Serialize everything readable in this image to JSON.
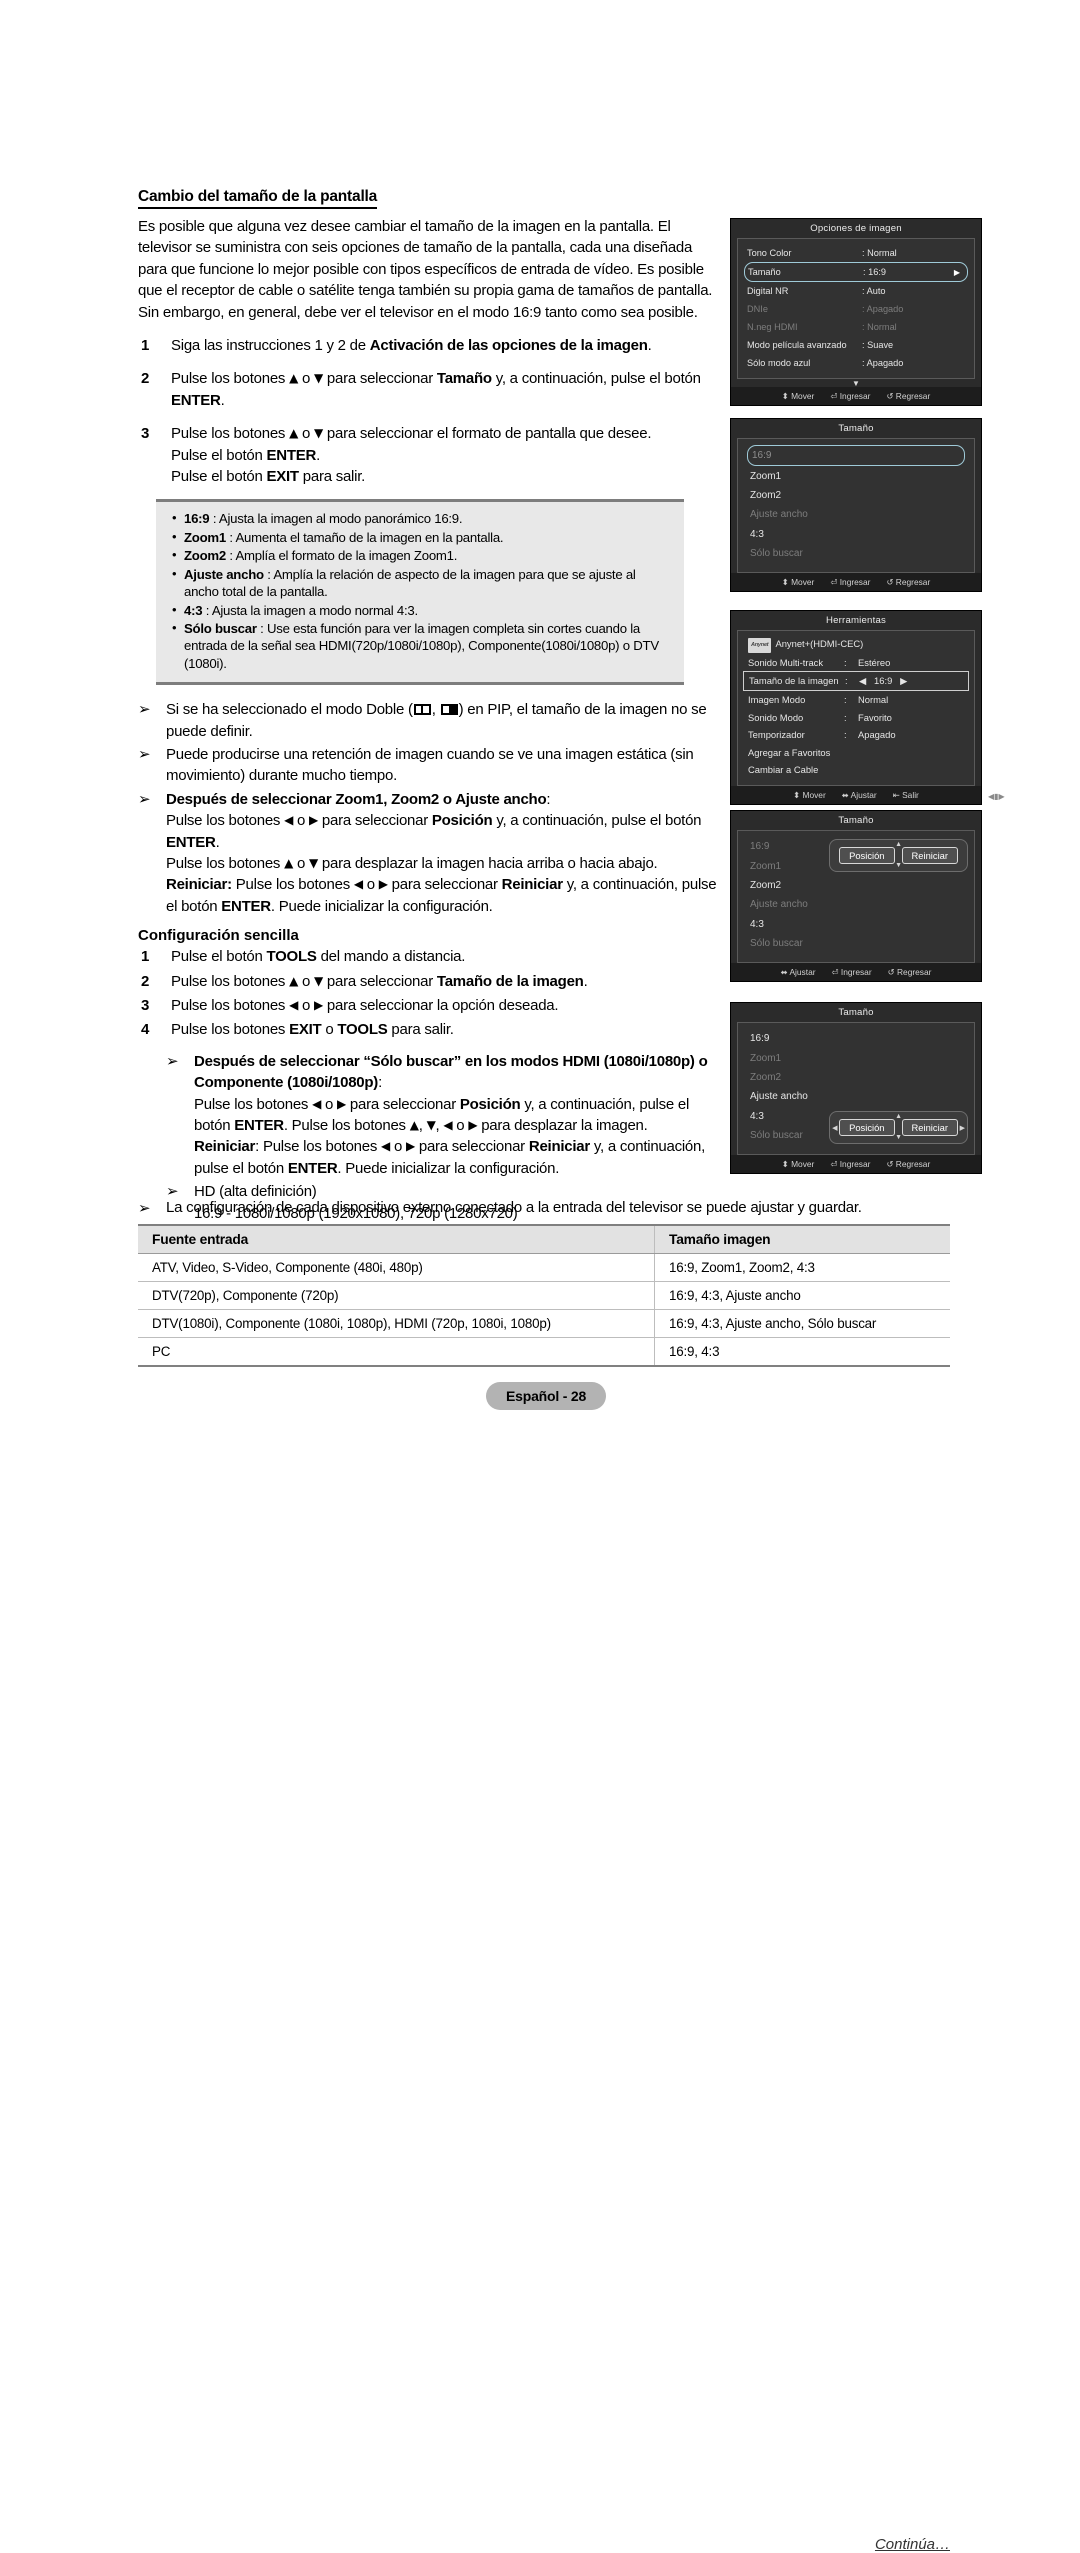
{
  "section": {
    "heading": "Cambio del tamaño de la pantalla",
    "intro": "Es posible que alguna vez desee cambiar el tamaño de la imagen en la pantalla. El televisor se suministra con seis opciones de tamaño de la pantalla, cada una diseñada para que funcione lo mejor posible con tipos específicos de entrada de vídeo. Es posible que el receptor de cable o satélite tenga también su propia gama de tamaños de pantalla. Sin embargo, en general, debe ver el televisor en el modo 16:9 tanto como sea posible."
  },
  "steps": [
    {
      "num": "1",
      "html": "Siga las instrucciones 1 y 2 de <b>Activación de las opciones de la imagen</b>."
    },
    {
      "num": "2",
      "html": "Pulse los botones <span class=\"ar\">▲</span> o <span class=\"ar\">▼</span> para seleccionar <b>Tamaño</b> y, a continuación, pulse el botón <b>ENTER</b>."
    },
    {
      "num": "3",
      "html": "Pulse los botones <span class=\"ar\">▲</span> o <span class=\"ar\">▼</span> para seleccionar el formato de pantalla que desee.<br>Pulse el botón <b>ENTER</b>.<br>Pulse el botón <b>EXIT</b> para salir."
    }
  ],
  "notebox": [
    {
      "html": "<b>16:9</b> : Ajusta la imagen al modo panorámico 16:9."
    },
    {
      "html": "<b>Zoom1</b> : Aumenta el tamaño de la imagen en la pantalla."
    },
    {
      "html": "<b>Zoom2</b> : Amplía el formato de la imagen Zoom1."
    },
    {
      "html": "<b>Ajuste ancho</b> : Amplía la relación de aspecto de la imagen para que se ajuste al ancho total de la pantalla."
    },
    {
      "html": "<b>4:3</b> : Ajusta la imagen a modo normal 4:3."
    },
    {
      "html": "<b>Sólo buscar</b> : Use esta función para ver la imagen completa sin cortes cuando la entrada de la señal sea HDMI(720p/1080i/1080p), Componente(1080i/1080p) o DTV (1080i)."
    }
  ],
  "arrow_notes": [
    {
      "html": "Si se ha seleccionado el modo Doble (<span class=\"dualicon\"></span>, <span class=\"dualicon filled\"></span>) en PIP, el tamaño de la imagen no se puede definir."
    },
    {
      "html": "Puede producirse una retención de imagen cuando se ve una imagen estática (sin movimiento) durante mucho tiempo."
    },
    {
      "html": "<b>Después de seleccionar Zoom1, Zoom2 o Ajuste ancho</b>:<br>Pulse los botones <span class=\"ar\">◀</span> o <span class=\"ar\">▶</span> para seleccionar <b>Posición</b> y, a continuación, pulse el botón <b>ENTER</b>.<br>Pulse los botones <span class=\"ar\">▲</span> o <span class=\"ar\">▼</span> para desplazar la imagen hacia arriba o hacia abajo.<br><b>Reiniciar:</b> Pulse los botones <span class=\"ar\">◀</span> o <span class=\"ar\">▶</span> para seleccionar <b>Reiniciar</b> y, a continuación, pulse el botón <b>ENTER</b>. Puede inicializar la configuración."
    }
  ],
  "simple": {
    "heading": "Configuración sencilla",
    "steps": [
      {
        "num": "1",
        "html": "Pulse el botón <b>TOOLS</b> del mando a distancia."
      },
      {
        "num": "2",
        "html": "Pulse los botones <span class=\"ar\">▲</span> o <span class=\"ar\">▼</span> para seleccionar <b>Tamaño de la imagen</b>."
      },
      {
        "num": "3",
        "html": "Pulse los botones <span class=\"ar\">◀</span> o <span class=\"ar\">▶</span> para seleccionar la opción deseada."
      },
      {
        "num": "4",
        "html": "Pulse los botones <b>EXIT</b> o <b>TOOLS</b> para salir."
      }
    ],
    "arrow_notes": [
      {
        "html": "<b>Después de seleccionar “Sólo buscar” en los modos HDMI (1080i/1080p) o Componente (1080i/1080p)</b>:<br>Pulse los botones <span class=\"ar\">◀</span> o <span class=\"ar\">▶</span> para seleccionar <b>Posición</b> y, a continuación, pulse el botón <b>ENTER</b>. Pulse los botones <span class=\"ar\">▲</span>, <span class=\"ar\">▼</span>, <span class=\"ar\">◀</span> o <span class=\"ar\">▶</span> para desplazar la imagen.<br><b>Reiniciar</b>: Pulse los botones <span class=\"ar\">◀</span> o <span class=\"ar\">▶</span> para seleccionar <b>Reiniciar</b> y, a continuación, pulse el botón <b>ENTER</b>. Puede inicializar la configuración."
      },
      {
        "html": "HD (alta definición)<br>16:9 - 1080i/1080p (1920x1080), 720p (1280x720)"
      }
    ]
  },
  "bottom": {
    "note": "La configuración de cada dispositivo externo conectado a la entrada del televisor se puede ajustar y guardar.",
    "table": {
      "headers": [
        "Fuente entrada",
        "Tamaño imagen"
      ],
      "rows": [
        [
          "ATV, Video, S-Video, Componente (480i, 480p)",
          "16:9, Zoom1, Zoom2, 4:3"
        ],
        [
          "DTV(720p), Componente (720p)",
          "16:9, 4:3, Ajuste ancho"
        ],
        [
          "DTV(1080i), Componente (1080i, 1080p), HDMI (720p, 1080i, 1080p)",
          "16:9, 4:3, Ajuste ancho, Sólo buscar"
        ],
        [
          "PC",
          "16:9, 4:3"
        ]
      ]
    },
    "continua": "Continúa…",
    "page_label": "Español - 28"
  },
  "osd": {
    "panel1": {
      "title": "Opciones de imagen",
      "rows": [
        {
          "label": "Tono Color",
          "value": ": Normal",
          "dim": false,
          "selected": false
        },
        {
          "label": "Tamaño",
          "value": ": 16:9",
          "dim": false,
          "selected": true
        },
        {
          "label": "Digital NR",
          "value": ": Auto",
          "dim": false,
          "selected": false
        },
        {
          "label": "DNIe",
          "value": ": Apagado",
          "dim": true,
          "selected": false
        },
        {
          "label": "N.neg HDMI",
          "value": ": Normal",
          "dim": true,
          "selected": false
        },
        {
          "label": "Modo película avanzado",
          "value": ": Suave",
          "dim": false,
          "selected": false
        },
        {
          "label": "Sólo modo azul",
          "value": ": Apagado",
          "dim": false,
          "selected": false
        }
      ],
      "footer": [
        "Mover",
        "Ingresar",
        "Regresar"
      ]
    },
    "panel2": {
      "title": "Tamaño",
      "items": [
        {
          "label": "16:9",
          "state": "selected"
        },
        {
          "label": "Zoom1",
          "state": "normal"
        },
        {
          "label": "Zoom2",
          "state": "normal"
        },
        {
          "label": "Ajuste ancho",
          "state": "dim"
        },
        {
          "label": "4:3",
          "state": "normal"
        },
        {
          "label": "Sólo buscar",
          "state": "dim"
        }
      ],
      "footer": [
        "Mover",
        "Ingresar",
        "Regresar"
      ]
    },
    "panel3": {
      "title": "Herramientas",
      "badge": "Anynet",
      "rows": [
        {
          "label": "Anynet+(HDMI-CEC)",
          "sep": "",
          "value": "",
          "boxed": false,
          "badge": true
        },
        {
          "label": "Sonido Multi-track",
          "sep": ":",
          "value": "Estéreo",
          "boxed": false
        },
        {
          "label": "Tamaño de la imagen",
          "sep": ":",
          "value": "16:9",
          "boxed": true
        },
        {
          "label": "Imagen Modo",
          "sep": ":",
          "value": "Normal",
          "boxed": false
        },
        {
          "label": "Sonido Modo",
          "sep": ":",
          "value": "Favorito",
          "boxed": false
        },
        {
          "label": "Temporizador",
          "sep": ":",
          "value": "Apagado",
          "boxed": false
        },
        {
          "label": "Agregar a Favoritos",
          "sep": "",
          "value": "",
          "boxed": false
        },
        {
          "label": "Cambiar a Cable",
          "sep": "",
          "value": "",
          "boxed": false
        }
      ],
      "footer": [
        "Mover",
        "Ajustar",
        "Salir"
      ]
    },
    "panel4": {
      "title": "Tamaño",
      "items": [
        {
          "label": "16:9",
          "state": "dim"
        },
        {
          "label": "Zoom1",
          "state": "dim"
        },
        {
          "label": "Zoom2",
          "state": "normal"
        },
        {
          "label": "Ajuste ancho",
          "state": "dim"
        },
        {
          "label": "4:3",
          "state": "normal"
        },
        {
          "label": "Sólo buscar",
          "state": "dim"
        }
      ],
      "popup": {
        "position": "Posición",
        "reset": "Reiniciar"
      },
      "footer": [
        "Ajustar",
        "Ingresar",
        "Regresar"
      ]
    },
    "panel5": {
      "title": "Tamaño",
      "items": [
        {
          "label": "16:9",
          "state": "normal"
        },
        {
          "label": "Zoom1",
          "state": "dim"
        },
        {
          "label": "Zoom2",
          "state": "dim"
        },
        {
          "label": "Ajuste ancho",
          "state": "normal"
        },
        {
          "label": "4:3",
          "state": "normal"
        },
        {
          "label": "Sólo buscar",
          "state": "dim"
        }
      ],
      "popup": {
        "position": "Posición",
        "reset": "Reiniciar"
      },
      "footer": [
        "Mover",
        "Ingresar",
        "Regresar"
      ]
    }
  }
}
